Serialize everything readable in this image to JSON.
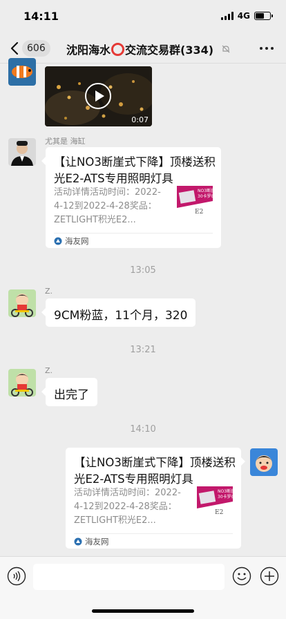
{
  "status_bar": {
    "time": "14:11",
    "network": "4G"
  },
  "header": {
    "unread_count": "606",
    "title_part1": "沈阳海水",
    "title_part2": "交流交易群(334)"
  },
  "messages": {
    "msg2": {
      "sender": "尤其是 海缸",
      "card_title": "【让NO3断崖式下降】顶楼送积光E2-ATS专用照明灯具",
      "card_desc": "活动详情活动时间：2022-4-12到2022-4-28奖品：ZETLIGHT积光E2...",
      "card_source": "海友网"
    },
    "time1": "13:05",
    "msg3": {
      "sender": "Z.",
      "text": "9CM粉蓝，11个月，320"
    },
    "time2": "13:21",
    "msg4": {
      "sender": "Z.",
      "text": "出完了"
    },
    "time3": "14:10",
    "msg5": {
      "card_title": "【让NO3断崖式下降】顶楼送积光E2-ATS专用照明灯具",
      "card_desc": "活动详情活动时间：2022-4-12到2022-4-28奖品：ZETLIGHT积光E2...",
      "card_source": "海友网"
    },
    "video": {
      "duration": "0:07"
    }
  },
  "thumb_text": {
    "line1": "NO3断崖",
    "line2": "30卡罗德",
    "brand": "E2"
  },
  "icons": [
    "back-icon",
    "mute-icon",
    "more-icon",
    "play-icon",
    "voice-icon",
    "emoji-icon",
    "add-icon",
    "source-logo-icon"
  ],
  "colors": {
    "background": "#ededed",
    "bubble": "#ffffff",
    "accent_red": "#e53935",
    "thumb_magenta": "#c2186b"
  }
}
